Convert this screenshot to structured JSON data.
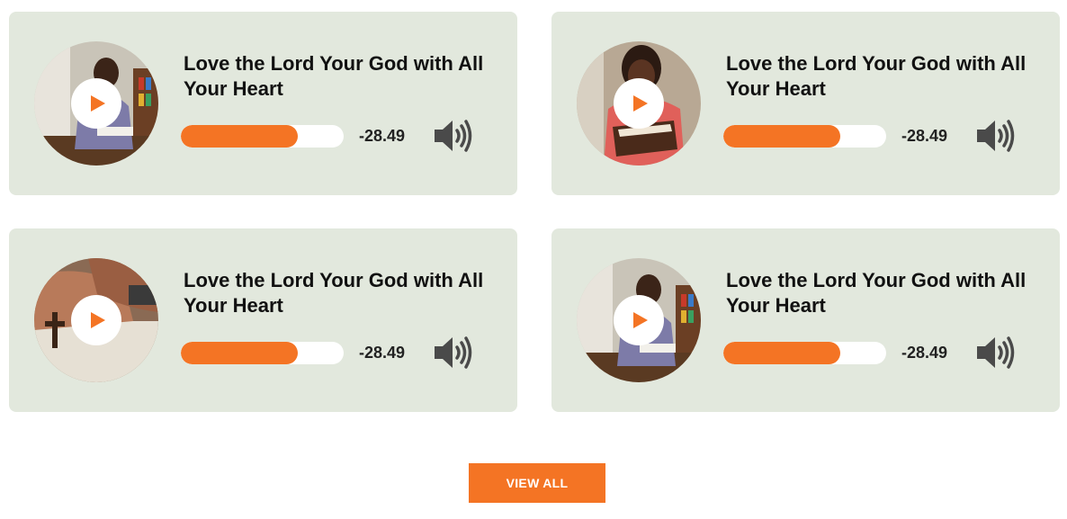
{
  "accent_color": "#f47424",
  "card_background": "#e2e8dd",
  "tracks": [
    {
      "title": "Love the Lord Your God with All Your Heart",
      "time": "-28.49",
      "progress": 0.72,
      "thumbnail": "man reading at church pew"
    },
    {
      "title": "Love the Lord Your God with All Your Heart",
      "time": "-28.49",
      "progress": 0.72,
      "thumbnail": "woman holding open bible"
    },
    {
      "title": "Love the Lord Your God with All Your Heart",
      "time": "-28.49",
      "progress": 0.72,
      "thumbnail": "hands holding rosary cross over book"
    },
    {
      "title": "Love the Lord Your God with All Your Heart",
      "time": "-28.49",
      "progress": 0.72,
      "thumbnail": "man reading at church pew"
    }
  ],
  "icons": {
    "play": "play-icon",
    "volume": "speaker-volume-icon"
  },
  "view_all_label": "VIEW ALL"
}
